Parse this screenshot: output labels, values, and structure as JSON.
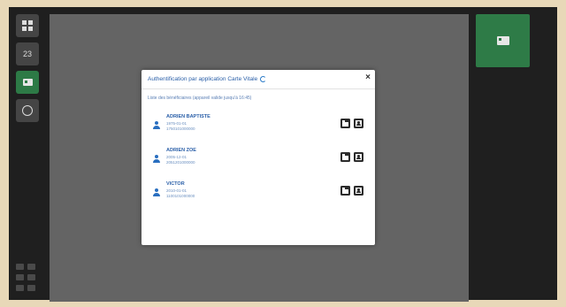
{
  "sidebar": {
    "items": [
      {
        "icon": "grid-icon",
        "label": ""
      },
      {
        "icon": "calendar-icon",
        "label": "23"
      },
      {
        "icon": "card-icon",
        "label": "",
        "active": true
      },
      {
        "icon": "globe-icon",
        "label": ""
      }
    ]
  },
  "modal": {
    "title": "Authentification par application Carte Vitale",
    "subtitle": "Liste des bénéficiaires (appareil valide jusqu'à 16:45)",
    "close_label": "×",
    "beneficiaries": [
      {
        "name": "ADRIEN BAPTISTE",
        "dob": "1975-01-01",
        "nir": "1750101000000"
      },
      {
        "name": "ADRIEN ZOE",
        "dob": "2005-12-01",
        "nir": "2051201000000"
      },
      {
        "name": "VICTOR",
        "dob": "2010-01-01",
        "nir": "1100101000000"
      }
    ]
  },
  "colors": {
    "accent": "#2d7a46",
    "link_blue": "#2a5fa8",
    "overlay": "#1f1f1f"
  }
}
